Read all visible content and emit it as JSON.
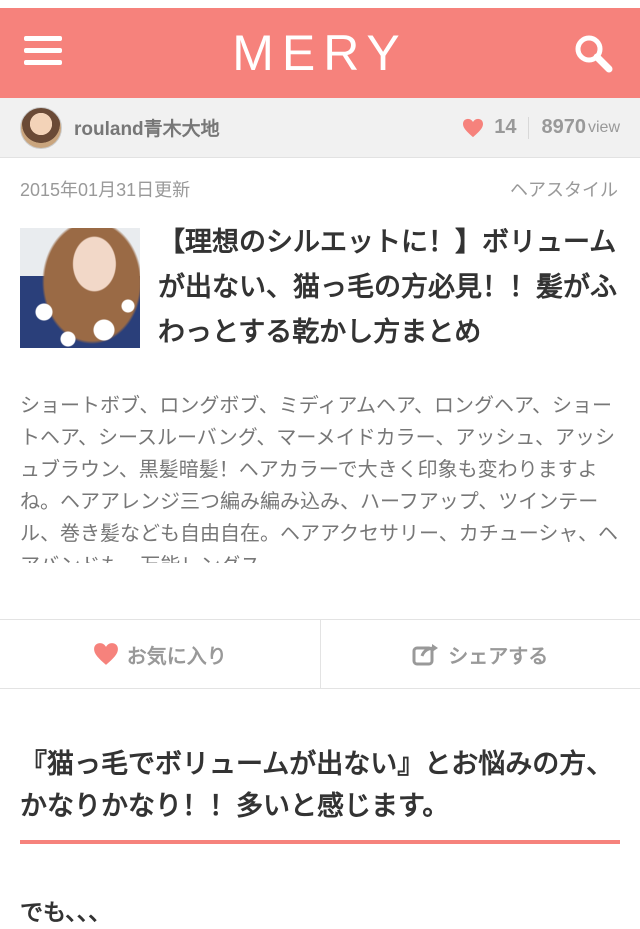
{
  "header": {
    "logo": "MERY",
    "brand_color": "#f6827c"
  },
  "author": {
    "name": "rouland青木大地",
    "likes": "14",
    "views": "8970",
    "views_unit": "view"
  },
  "meta": {
    "date": "2015年01月31日更新",
    "category": "ヘアスタイル"
  },
  "article": {
    "title": "【理想のシルエットに！】ボリュームが出ない、猫っ毛の方必見！！髪がふわっとする乾かし方まとめ",
    "summary": "ショートボブ、ロングボブ、ミディアムヘア、ロングヘア、ショートヘア、シースルーバング、マーメイドカラー、アッシュ、アッシュブラウン、黒髪暗髪！ヘアカラーで大きく印象も変わりますよね。ヘアアレンジ三つ編み編み込み、ハーフアップ、ツインテール、巻き髪なども自由自在。ヘアアクセサリー、カチューシャ、ヘアバンドも。万能レングス"
  },
  "actions": {
    "favorite_label": "お気に入り",
    "share_label": "シェアする"
  },
  "section": {
    "heading": "『猫っ毛でボリュームが出ない』とお悩みの方、かなりかなり！！多いと感じます。",
    "body": "でも、、、"
  }
}
